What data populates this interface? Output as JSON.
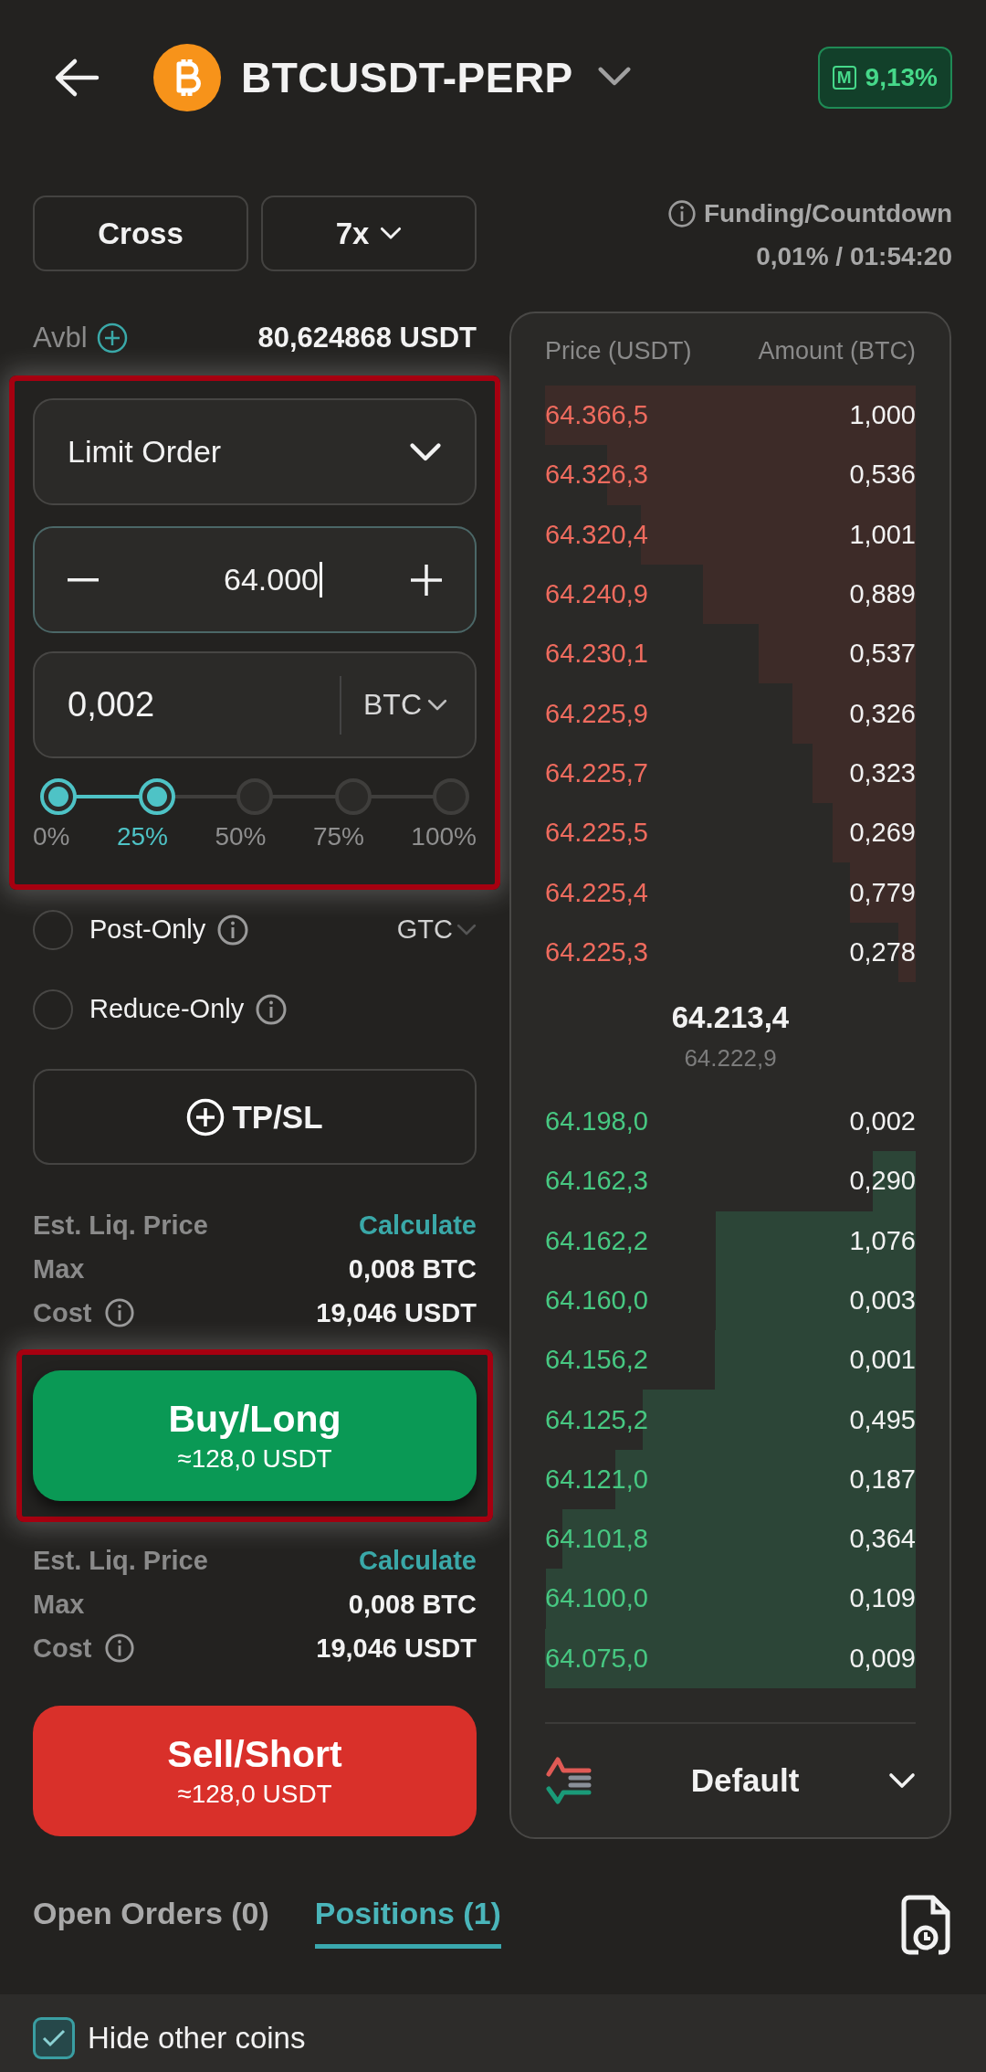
{
  "header": {
    "symbol": "BTCUSDT-PERP",
    "badge_letter": "M",
    "badge_value": "9,13%"
  },
  "margin": {
    "mode": "Cross",
    "leverage": "7x"
  },
  "funding": {
    "label": "Funding/Countdown",
    "value": "0,01% / 01:54:20"
  },
  "available": {
    "label": "Avbl",
    "value": "80,624868 USDT"
  },
  "order_entry": {
    "highlighted": true,
    "order_type": "Limit Order",
    "price": "64.000",
    "amount": "0,002",
    "unit": "BTC",
    "percent_slider": {
      "level": 0.25,
      "stops": [
        {
          "label": "0%",
          "selected": false
        },
        {
          "label": "25%",
          "selected": true
        },
        {
          "label": "50%",
          "selected": false
        },
        {
          "label": "75%",
          "selected": false
        },
        {
          "label": "100%",
          "selected": false
        }
      ]
    }
  },
  "options": [
    {
      "label": "Post-Only",
      "checked": false
    },
    {
      "label": "Reduce-Only",
      "checked": false
    }
  ],
  "time_in_force": "GTC",
  "tpsl_button": "TP/SL",
  "buy": {
    "highlighted": true,
    "label": "Buy/Long",
    "amount": "≈128,0 USDT",
    "info": [
      {
        "kind": "link",
        "label": "Est. Liq. Price",
        "value": "Calculate"
      },
      {
        "kind": "value",
        "label": "Max",
        "value": "0,008 BTC"
      },
      {
        "kind": "info",
        "label": "Cost",
        "value": "19,046 USDT"
      }
    ]
  },
  "sell": {
    "label": "Sell/Short",
    "amount": "≈128,0 USDT",
    "info": [
      {
        "kind": "link",
        "label": "Est. Liq. Price",
        "value": "Calculate"
      },
      {
        "kind": "value",
        "label": "Max",
        "value": "0,008 BTC"
      },
      {
        "kind": "info",
        "label": "Cost",
        "value": "19,046 USDT"
      }
    ]
  },
  "order_book": {
    "columns": [
      "Price (USDT)",
      "Amount (BTC)"
    ],
    "asks": [
      {
        "price": "64.366,5",
        "amount": "1,000"
      },
      {
        "price": "64.326,3",
        "amount": "0,536"
      },
      {
        "price": "64.320,4",
        "amount": "1,001"
      },
      {
        "price": "64.240,9",
        "amount": "0,889"
      },
      {
        "price": "64.230,1",
        "amount": "0,537"
      },
      {
        "price": "64.225,9",
        "amount": "0,326"
      },
      {
        "price": "64.225,7",
        "amount": "0,323"
      },
      {
        "price": "64.225,5",
        "amount": "0,269"
      },
      {
        "price": "64.225,4",
        "amount": "0,779"
      },
      {
        "price": "64.225,3",
        "amount": "0,278"
      }
    ],
    "last_price": "64.213,4",
    "mark_price": "64.222,9",
    "bids": [
      {
        "price": "64.198,0",
        "amount": "0,002"
      },
      {
        "price": "64.162,3",
        "amount": "0,290"
      },
      {
        "price": "64.162,2",
        "amount": "1,076"
      },
      {
        "price": "64.160,0",
        "amount": "0,003"
      },
      {
        "price": "64.156,2",
        "amount": "0,001"
      },
      {
        "price": "64.125,2",
        "amount": "0,495"
      },
      {
        "price": "64.121,0",
        "amount": "0,187"
      },
      {
        "price": "64.101,8",
        "amount": "0,364"
      },
      {
        "price": "64.100,0",
        "amount": "0,109"
      },
      {
        "price": "64.075,0",
        "amount": "0,009"
      }
    ],
    "view": "Default"
  },
  "tabs": [
    {
      "label": "Open Orders (0)",
      "selected": false
    },
    {
      "label": "Positions (1)",
      "selected": true
    }
  ],
  "filter": {
    "label": "Hide other coins",
    "checked": true
  }
}
